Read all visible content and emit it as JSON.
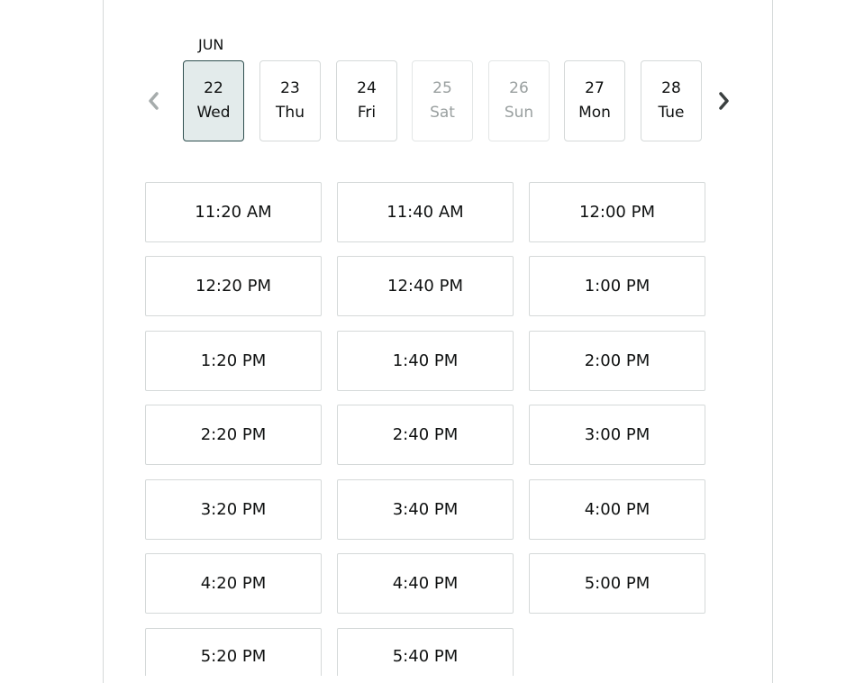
{
  "calendar": {
    "month": "JUN",
    "days": [
      {
        "date": "22",
        "weekday": "Wed",
        "state": "selected"
      },
      {
        "date": "23",
        "weekday": "Thu",
        "state": "available"
      },
      {
        "date": "24",
        "weekday": "Fri",
        "state": "available"
      },
      {
        "date": "25",
        "weekday": "Sat",
        "state": "disabled"
      },
      {
        "date": "26",
        "weekday": "Sun",
        "state": "disabled"
      },
      {
        "date": "27",
        "weekday": "Mon",
        "state": "available"
      },
      {
        "date": "28",
        "weekday": "Tue",
        "state": "available"
      }
    ],
    "icons": {
      "prev": "chevron-left-icon",
      "next": "chevron-right-icon"
    },
    "colors": {
      "selected_bg": "#e3ebeb",
      "selected_border": "#2f4f4f",
      "disabled_text": "#9aa0a0",
      "border": "#d5d9d9"
    }
  },
  "time_slots": [
    "11:20 AM",
    "11:40 AM",
    "12:00 PM",
    "12:20 PM",
    "12:40 PM",
    "1:00 PM",
    "1:20 PM",
    "1:40 PM",
    "2:00 PM",
    "2:20 PM",
    "2:40 PM",
    "3:00 PM",
    "3:20 PM",
    "3:40 PM",
    "4:00 PM",
    "4:20 PM",
    "4:40 PM",
    "5:00 PM",
    "5:20 PM",
    "5:40 PM"
  ]
}
